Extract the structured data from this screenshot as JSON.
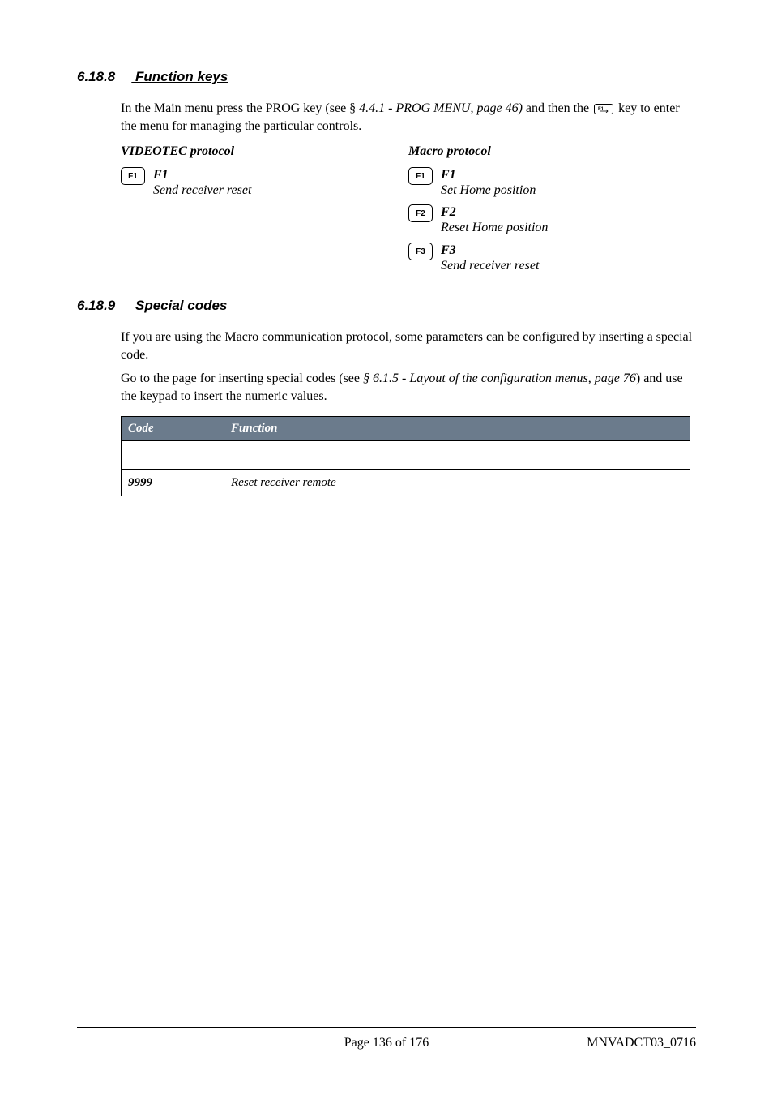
{
  "sections": {
    "s1": {
      "number": "6.18.8",
      "title": "Function keys",
      "intro_part1": "In the Main menu press the PROG key (see § ",
      "intro_ref": "4.4.1 - PROG MENU, page 46)",
      "intro_part2": " and then the ",
      "intro_part3": " key to enter the menu for managing the particular controls."
    },
    "s2": {
      "number": "6.18.9",
      "title": "Special codes",
      "para1": "If you are using the Macro communication protocol, some parameters can be configured by inserting a special code.",
      "para2_pre": "Go to the page for inserting special codes (see ",
      "para2_ref": "§ 6.1.5 - Layout of the configuration menus, page  76",
      "para2_post": ") and use the keypad to insert the numeric values."
    }
  },
  "protocols": {
    "videotec": {
      "title": "VIDEOTEC protocol",
      "keys": [
        {
          "box": "F1",
          "label": "F1",
          "desc": "Send receiver reset"
        }
      ]
    },
    "macro": {
      "title": "Macro protocol",
      "keys": [
        {
          "box": "F1",
          "label": "F1",
          "desc": "Set Home position"
        },
        {
          "box": "F2",
          "label": "F2",
          "desc": "Reset Home position"
        },
        {
          "box": "F3",
          "label": "F3",
          "desc": "Send receiver reset"
        }
      ]
    }
  },
  "codes_table": {
    "headers": {
      "code": "Code",
      "function": "Function"
    },
    "rows": [
      {
        "code": "9999",
        "function": "Reset receiver remote"
      }
    ]
  },
  "footer": {
    "center": "Page 136 of 176",
    "right": "MNVADCT03_0716"
  }
}
